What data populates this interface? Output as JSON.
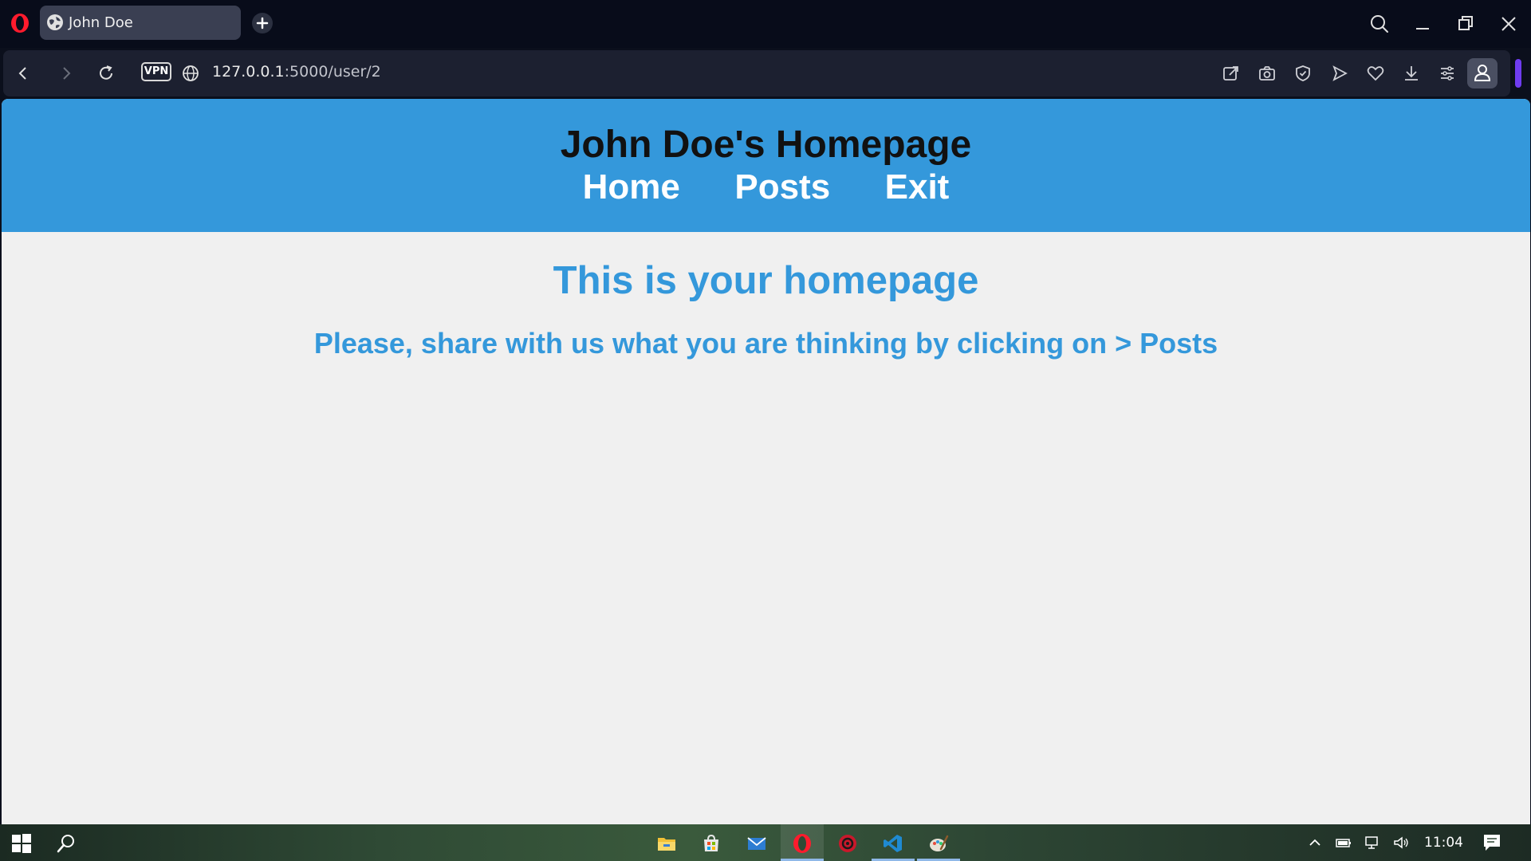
{
  "browser": {
    "tab_title": "John Doe",
    "vpn_label": "VPN",
    "url_host": "127.0.0.1",
    "url_rest": ":5000/user/2",
    "accent_color": "#6f3cf0"
  },
  "page": {
    "site_title": "John Doe's Homepage",
    "nav": [
      "Home",
      "Posts",
      "Exit"
    ],
    "heading": "This is your homepage",
    "subheading": "Please, share with us what you are thinking by clicking on > Posts",
    "header_color": "#3498db",
    "background_color": "#f0f0f0"
  },
  "taskbar": {
    "clock": "11:04",
    "pinned_icons": [
      "file-explorer-icon",
      "store-icon",
      "mail-icon",
      "opera-icon",
      "app-icon",
      "vscode-icon",
      "paint-icon"
    ]
  }
}
